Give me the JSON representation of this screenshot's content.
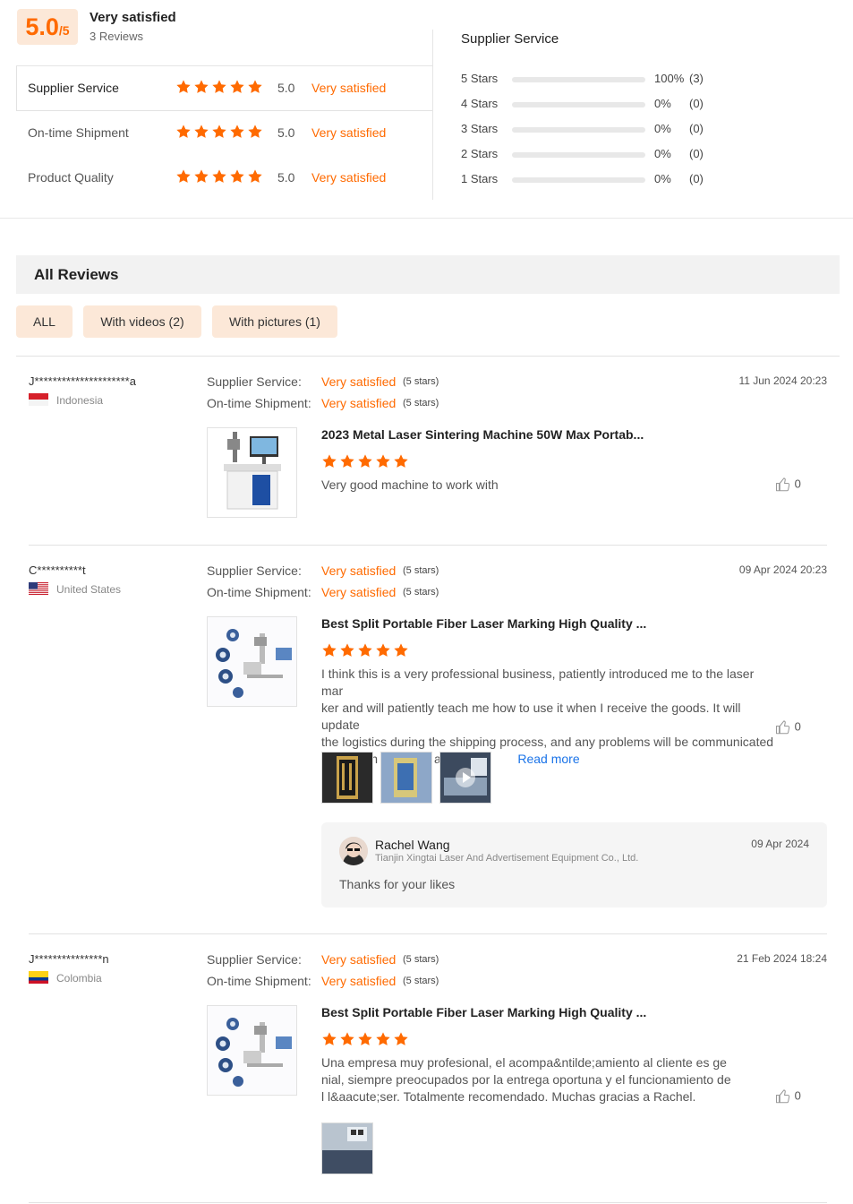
{
  "summary": {
    "score": "5.0",
    "score_max": "/5",
    "overall_label": "Very satisfied",
    "review_count": "3 Reviews",
    "dimensions": [
      {
        "label": "Supplier Service",
        "value": "5.0",
        "text": "Very satisfied",
        "stars": 5
      },
      {
        "label": "On-time Shipment",
        "value": "5.0",
        "text": "Very satisfied",
        "stars": 5
      },
      {
        "label": "Product Quality",
        "value": "5.0",
        "text": "Very satisfied",
        "stars": 5
      }
    ],
    "distribution_title": "Supplier Service",
    "distribution": [
      {
        "label": "5  Stars",
        "fraction": 1.0,
        "pct": "100%",
        "count": "(3)"
      },
      {
        "label": "4  Stars",
        "fraction": 0.0,
        "pct": "0%",
        "count": "(0)"
      },
      {
        "label": "3  Stars",
        "fraction": 0.0,
        "pct": "0%",
        "count": "(0)"
      },
      {
        "label": "2  Stars",
        "fraction": 0.0,
        "pct": "0%",
        "count": "(0)"
      },
      {
        "label": "1  Stars",
        "fraction": 0.0,
        "pct": "0%",
        "count": "(0)"
      }
    ]
  },
  "all_reviews": {
    "title": "All Reviews",
    "filters": [
      "ALL",
      "With videos (2)",
      "With pictures (1)"
    ]
  },
  "reviews": [
    {
      "user": "J*********************a",
      "country": "Indonesia",
      "date": "11 Jun 2024 20:23",
      "supplier_label": "Supplier Service:",
      "supplier_value": "Very satisfied",
      "supplier_stars": "(5 stars)",
      "shipment_label": "On-time Shipment:",
      "shipment_value": "Very satisfied",
      "shipment_stars": "(5 stars)",
      "product": "2023 Metal Laser Sintering Machine 50W Max Portab...",
      "text": "Very good machine to work with",
      "likes": "0"
    },
    {
      "user": "C**********t",
      "country": "United States",
      "date": "09 Apr 2024 20:23",
      "supplier_label": "Supplier Service:",
      "supplier_value": "Very satisfied",
      "supplier_stars": "(5 stars)",
      "shipment_label": "On-time Shipment:",
      "shipment_value": "Very satisfied",
      "shipment_stars": "(5 stars)",
      "product": "Best Split Portable Fiber Laser Marking High Quality ...",
      "text_lines": [
        "I think this is a very professional business, patiently introduced me to the laser mar",
        "ker and will patiently teach me how to use it when I receive the goods. It will update",
        "the logistics during the shipping process, and any problems will be communicated",
        "with me in time, it is a v..."
      ],
      "read_more": "Read more",
      "likes": "0",
      "reply": {
        "name": "Rachel Wang",
        "company": "Tianjin Xingtai Laser And Advertisement Equipment Co., Ltd.",
        "date": "09 Apr 2024",
        "text": "Thanks for your likes"
      }
    },
    {
      "user": "J***************n",
      "country": "Colombia",
      "date": "21 Feb 2024 18:24",
      "supplier_label": "Supplier Service:",
      "supplier_value": "Very satisfied",
      "supplier_stars": "(5 stars)",
      "shipment_label": "On-time Shipment:",
      "shipment_value": "Very satisfied",
      "shipment_stars": "(5 stars)",
      "product": "Best Split Portable Fiber Laser Marking High Quality ...",
      "text_lines": [
        "Una empresa muy profesional, el acompa&ntilde;amiento al cliente es ge",
        "nial, siempre preocupados por la entrega oportuna y el funcionamiento de",
        "l l&aacute;ser. Totalmente recomendado. Muchas gracias a Rachel."
      ],
      "likes": "0"
    }
  ],
  "colors": {
    "accent": "#ff6a00",
    "accent_light": "#fce8d8"
  }
}
